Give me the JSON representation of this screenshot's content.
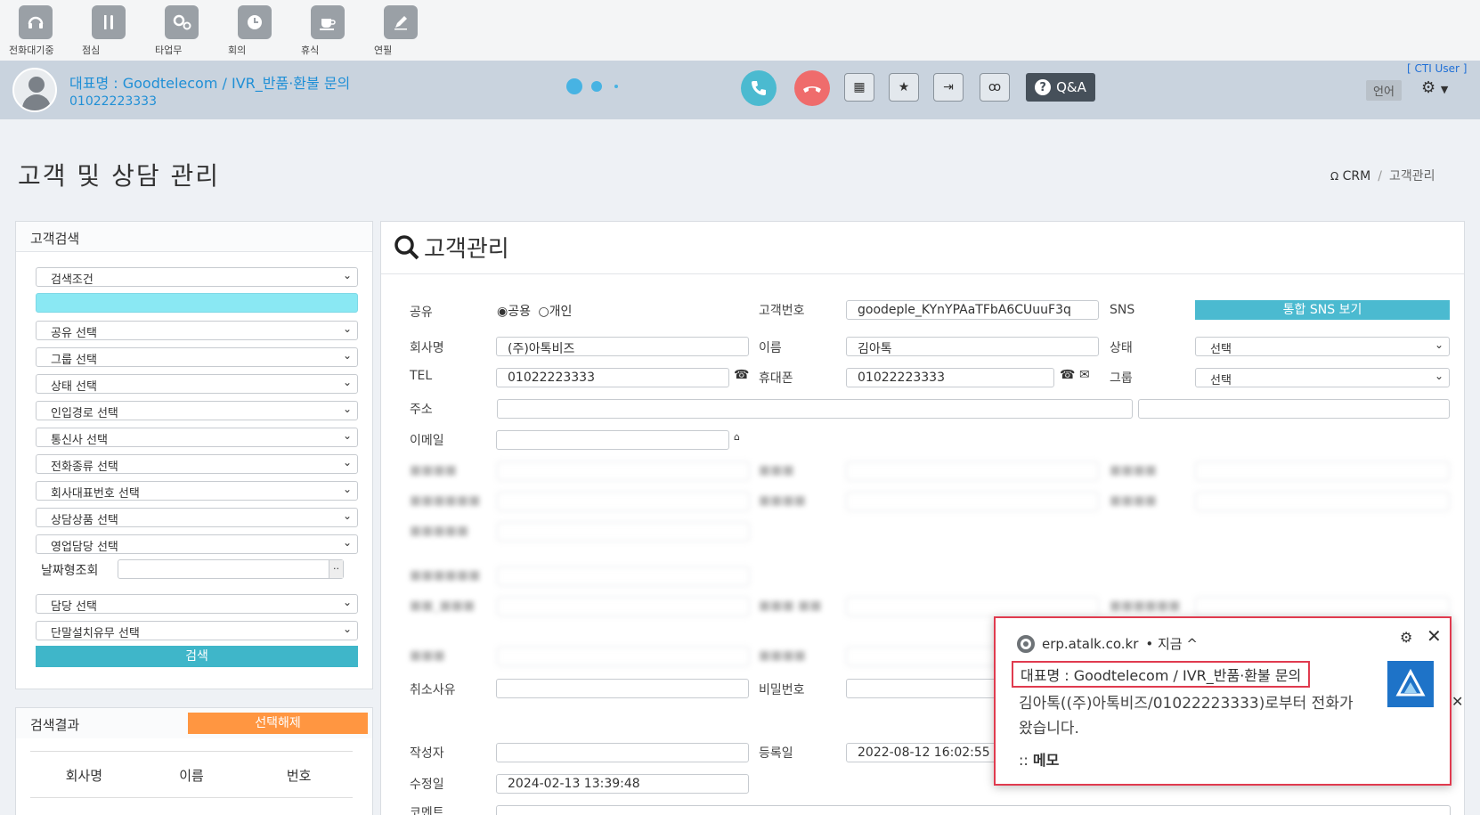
{
  "status_bar": {
    "items": [
      {
        "label": "전화대기중",
        "icon": "headset-icon"
      },
      {
        "label": "점심",
        "icon": "utensils-icon"
      },
      {
        "label": "타업무",
        "icon": "gears-icon"
      },
      {
        "label": "회의",
        "icon": "clock-icon"
      },
      {
        "label": "휴식",
        "icon": "coffee-icon"
      },
      {
        "label": "연필",
        "icon": "pencil-icon"
      }
    ]
  },
  "call_bar": {
    "title": "대표명 : Goodtelecom / IVR_반품·환불 문의",
    "number": "01022223333",
    "cti_user": "[ CTI User ]",
    "language": "언어",
    "qa_label": "Q&A"
  },
  "page": {
    "title": "고객 및 상담 관리",
    "breadcrumb": [
      "CRM",
      "고객관리"
    ]
  },
  "search_panel": {
    "heading": "고객검색",
    "selects": [
      "검색조건",
      "공유 선택",
      "그룹 선택",
      "상태 선택",
      "인입경로 선택",
      "통신사 선택",
      "전화종류 선택",
      "회사대표번호 선택",
      "상담상품 선택",
      "영업담당 선택"
    ],
    "date_label": "날짜형조회",
    "date_btn": "..",
    "selects_after": [
      "담당 선택",
      "단말설치유무 선택"
    ],
    "search_button": "검색"
  },
  "results_panel": {
    "heading": "검색결과",
    "unselect_button": "선택해제",
    "columns": [
      "회사명",
      "이름",
      "번호"
    ]
  },
  "customer": {
    "heading": "고객관리",
    "share_label": "공유",
    "share_options": [
      "공용",
      "개인"
    ],
    "customer_no_label": "고객번호",
    "customer_no": "goodeple_KYnYPAaTFbA6CUuuF3q",
    "sns_label": "SNS",
    "sns_button": "통합 SNS 보기",
    "company_label": "회사명",
    "company": "(주)아톡비즈",
    "name_label": "이름",
    "name": "김아톡",
    "status_label": "상태",
    "status_value": "선택",
    "tel_label": "TEL",
    "tel": "01022223333",
    "mobile_label": "휴대폰",
    "mobile": "01022223333",
    "group_label": "그룹",
    "group_value": "선택",
    "address_label": "주소",
    "email_label": "이메일",
    "cancel_reason_label": "취소사유",
    "password_label": "비밀번호",
    "author_label": "작성자",
    "reg_date_label": "등록일",
    "reg_date": "2022-08-12 16:02:55",
    "mod_date_label": "수정일",
    "mod_date": "2024-02-13 13:39:48",
    "comment_label": "코멘트"
  },
  "notification": {
    "source": "erp.atalk.co.kr",
    "time": "• 지금 ^",
    "title": "대표명 : Goodtelecom / IVR_반품·환불 문의",
    "message": "김아톡((주)아톡비즈/01022223333)로부터 전화가 왔습니다.",
    "memo_prefix": "::",
    "memo": "메모"
  }
}
